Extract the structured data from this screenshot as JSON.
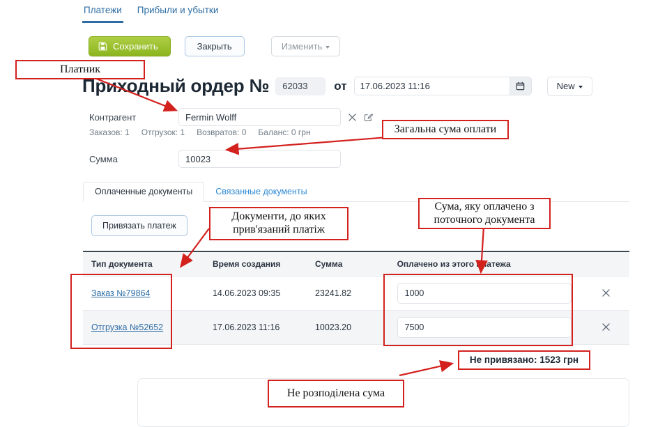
{
  "top_tabs": [
    {
      "label": "Платежи",
      "active": true
    },
    {
      "label": "Прибыли и убытки",
      "active": false
    }
  ],
  "toolbar": {
    "save_label": "Сохранить",
    "close_label": "Закрыть",
    "change_label": "Изменить",
    "save_icon": "floppy-disk-icon",
    "accent_green": "#9bc030",
    "accent_blue": "#2e6da4"
  },
  "document": {
    "title": "Приходный ордер №",
    "number": "62033",
    "from_label": "от",
    "date": "17.06.2023 11:16",
    "calendar_icon": "calendar-icon",
    "new_button_label": "New"
  },
  "form": {
    "counterparty_label": "Контрагент",
    "counterparty_value": "Fermin Wolff",
    "clear_icon": "close-icon",
    "edit_icon": "edit-pencil-icon",
    "meta": [
      "Заказов: 1",
      "Отгрузок: 1",
      "Возвратов: 0",
      "Баланс: 0 грн"
    ],
    "amount_label": "Сумма",
    "amount_value": "10023"
  },
  "inner_tabs": [
    {
      "label": "Оплаченные документы",
      "active": true
    },
    {
      "label": "Связанные документы",
      "active": false
    }
  ],
  "bind_payment_button": "Привязать платеж",
  "table": {
    "columns": [
      "Тип документа",
      "Время создания",
      "Сумма",
      "Оплачено из этого платежа",
      ""
    ],
    "rows": [
      {
        "doc": "Заказ №79864",
        "created": "14.06.2023 09:35",
        "sum": "23241.82",
        "paid": "1000",
        "remove_icon": "close-icon"
      },
      {
        "doc": "Отгрузка №52652",
        "created": "17.06.2023 11:16",
        "sum": "10023.20",
        "paid": "7500",
        "remove_icon": "close-icon"
      }
    ]
  },
  "annotations": {
    "payer": "Платник",
    "total_payment": "Загальна сума оплати",
    "linked_documents": "Документи, до яких\nприв'язаний платіж",
    "linked_documents_l1": "Документи, до яких",
    "linked_documents_l2": "прив'язаний платіж",
    "paid_from_current_l1": "Сума, яку оплачено з",
    "paid_from_current_l2": "поточного документа",
    "unallocated_sum": "Не розподілена сума",
    "unbound_value": "Не привязано: 1523 грн",
    "annotation_color": "#d3211e"
  }
}
